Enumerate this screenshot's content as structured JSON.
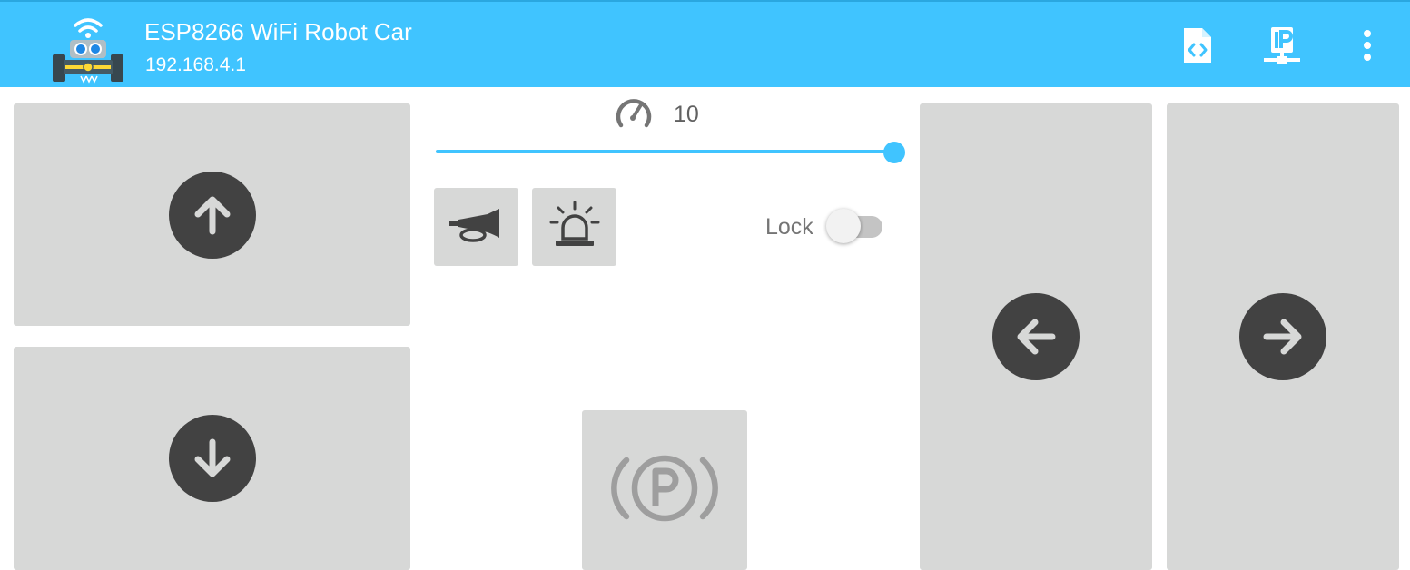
{
  "app": {
    "title": "ESP8266 WiFi Robot Car",
    "ip_address": "192.168.4.1",
    "logo_icon": "robot-car-wifi-icon",
    "actions": [
      {
        "name": "source-code-action",
        "icon": "code-file-icon"
      },
      {
        "name": "ip-settings-action",
        "icon": "ip-network-icon"
      },
      {
        "name": "more-options-action",
        "icon": "more-vert-icon"
      }
    ]
  },
  "controls": {
    "forward": {
      "icon": "arrow-up-circle-icon"
    },
    "backward": {
      "icon": "arrow-down-circle-icon"
    },
    "left": {
      "icon": "arrow-left-circle-icon"
    },
    "right": {
      "icon": "arrow-right-circle-icon"
    },
    "horn": {
      "icon": "horn-icon"
    },
    "light": {
      "icon": "siren-light-icon"
    },
    "parking_brake": {
      "icon": "parking-brake-icon"
    }
  },
  "speed": {
    "icon": "speedometer-icon",
    "value": "10",
    "slider_fraction": 1.0
  },
  "lock": {
    "label": "Lock",
    "enabled": false
  },
  "colors": {
    "app_bar": "#40c4ff",
    "accent": "#40c4ff",
    "pad_background": "#d7d8d7",
    "icon_dark": "#424242",
    "icon_muted": "#9e9e9e"
  }
}
